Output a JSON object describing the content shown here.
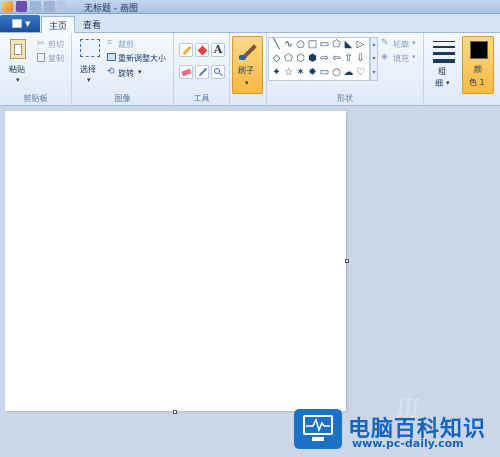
{
  "window": {
    "title": "无标题 - 画图"
  },
  "tabs": [
    {
      "label": "主页",
      "active": true
    },
    {
      "label": "查看",
      "active": false
    }
  ],
  "clipboard": {
    "paste": "粘贴",
    "cut": "剪切",
    "copy": "复制",
    "group": "剪贴板"
  },
  "image": {
    "select": "选择",
    "crop": "裁剪",
    "resize": "重新调整大小",
    "rotate": "旋转",
    "group": "图像"
  },
  "tools": {
    "group": "工具",
    "items": [
      "pencil-icon",
      "fill-icon",
      "text-icon",
      "eraser-icon",
      "color-picker-icon",
      "magnifier-icon"
    ]
  },
  "brushes": {
    "label": "刷子"
  },
  "shapes": {
    "group": "形状",
    "outline": "轮廓",
    "fill": "填充",
    "glyphs": [
      "╲",
      "∿",
      "○",
      "□",
      "▭",
      "⬠",
      "◣",
      "▷",
      "◇",
      "⬠",
      "⬡",
      "⬢",
      "⇨",
      "⇦",
      "⇧",
      "⇩",
      "✦",
      "☆",
      "✶",
      "✸",
      "▭",
      "○",
      "☁",
      "♡"
    ]
  },
  "size": {
    "label_top": "粗",
    "label_bottom": "细"
  },
  "color": {
    "label_top": "颜",
    "label_bottom": "色 1",
    "value": "#000000"
  },
  "watermark": {
    "brand": "电脑百科知识",
    "url": "www.pc-daily.com"
  },
  "colors": {
    "ribbon_bg": "#f5f9fe",
    "workspace": "#cbd7e8",
    "accent": "#f7b940",
    "brand": "#1565c0"
  }
}
